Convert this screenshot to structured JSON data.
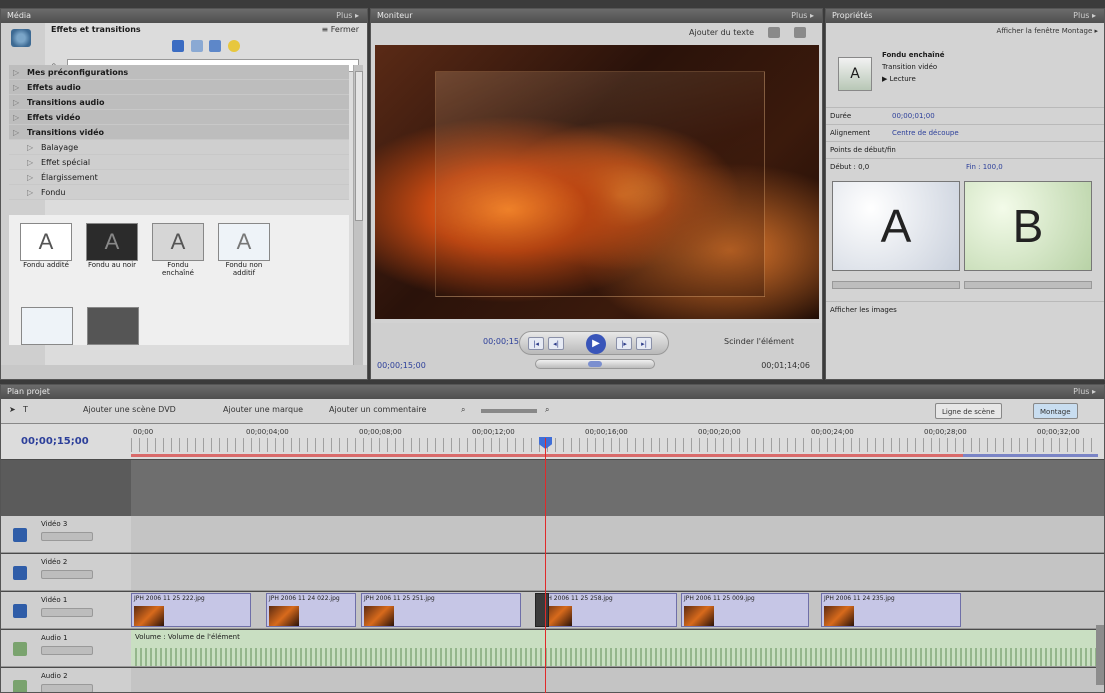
{
  "panels": {
    "media": {
      "title": "Média",
      "more": "Plus ▸"
    },
    "monitor": {
      "title": "Moniteur",
      "more": "Plus ▸"
    },
    "properties": {
      "title": "Propriétés",
      "more": "Plus ▸"
    },
    "project": {
      "title": "Plan projet",
      "more": "Plus ▸"
    }
  },
  "media": {
    "section_title": "Effets et transitions",
    "close": "≡ Fermer",
    "search_value": "",
    "tree": [
      {
        "label": "Mes préconfigurations",
        "bold": true,
        "child": false
      },
      {
        "label": "Effets audio",
        "bold": true,
        "child": false
      },
      {
        "label": "Transitions audio",
        "bold": true,
        "child": false
      },
      {
        "label": "Effets vidéo",
        "bold": true,
        "child": false
      },
      {
        "label": "Transitions vidéo",
        "bold": true,
        "child": false
      },
      {
        "label": "Balayage",
        "bold": false,
        "child": true
      },
      {
        "label": "Effet spécial",
        "bold": false,
        "child": true
      },
      {
        "label": "Élargissement",
        "bold": false,
        "child": true
      },
      {
        "label": "Fondu",
        "bold": false,
        "child": true
      }
    ],
    "thumbnails": [
      {
        "glyph": "A",
        "label": "Fondu addité",
        "bg": "#ffffff",
        "fg": "#555555"
      },
      {
        "glyph": "A",
        "label": "Fondu au noir",
        "bg": "#2b2b2b",
        "fg": "#888888"
      },
      {
        "glyph": "A",
        "label": "Fondu enchaîné",
        "bg": "#d6d6d6",
        "fg": "#555555"
      },
      {
        "glyph": "A",
        "label": "Fondu non additif",
        "bg": "#eef3f8",
        "fg": "#777777"
      }
    ]
  },
  "monitor": {
    "add_text": "Ajouter du texte",
    "timecode_left": "00;00;15;00",
    "timecode_right": "00;01;14;06",
    "timecode_mid": "00;00;15;00",
    "split": "Scinder l'élément"
  },
  "properties": {
    "link": "Afficher la fenêtre Montage ▸",
    "item_name": "Fondu enchaîné",
    "item_type": "Transition vidéo",
    "play_label": "▶ Lecture",
    "rows": [
      {
        "label": "Durée",
        "value": "00;00;01;00"
      },
      {
        "label": "Alignement",
        "value": "Centre de découpe"
      },
      {
        "label": "Points de début/fin",
        "value": ""
      },
      {
        "label": "Début : 0,0",
        "value": "Fin : 100,0"
      }
    ],
    "a_label": "A",
    "b_label": "B",
    "show_images": "Afficher les images"
  },
  "project": {
    "toolbar": {
      "add_dvd_scene": "Ajouter une scène DVD",
      "add_marker": "Ajouter une marque",
      "add_comment": "Ajouter un commentaire",
      "scene_line": "Ligne de scène",
      "montage": "Montage"
    },
    "timecode": "00;00;15;00",
    "ruler_labels": [
      "00;00",
      "00;00;04;00",
      "00;00;08;00",
      "00;00;12;00",
      "00;00;16;00",
      "00;00;20;00",
      "00;00;24;00",
      "00;00;28;00",
      "00;00;32;00"
    ],
    "tracks": [
      {
        "name": "Vidéo 3",
        "type": "video",
        "clips": []
      },
      {
        "name": "Vidéo 2",
        "type": "video",
        "clips": []
      },
      {
        "name": "Vidéo 1",
        "type": "video",
        "clips": [
          "JPH 2006 11 25 222.jpg",
          "JPH 2006 11 24 022.jpg",
          "JPH 2006 11 25 251.jpg",
          "JPH 2006 11 25 258.jpg",
          "JPH 2006 11 25 009.jpg",
          "JPH 2006 11 24 235.jpg"
        ]
      },
      {
        "name": "Audio 1",
        "type": "audio",
        "clips": [
          "Volume : Volume de l'élément"
        ]
      },
      {
        "name": "Audio 2",
        "type": "audio",
        "clips": []
      }
    ]
  }
}
